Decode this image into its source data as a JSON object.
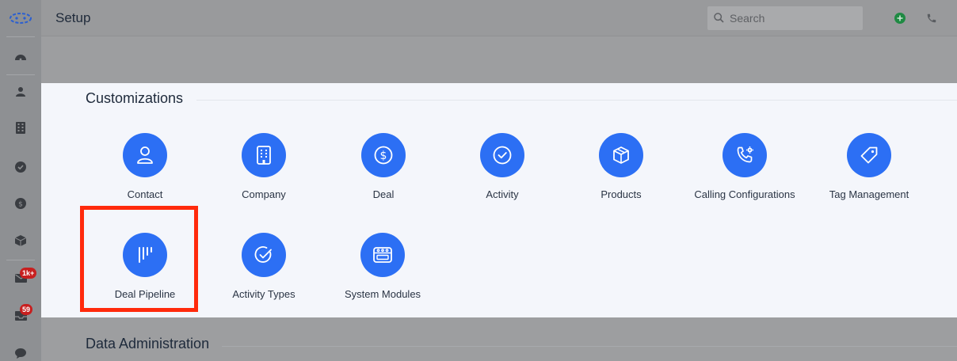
{
  "header": {
    "title": "Setup",
    "search_placeholder": "Search"
  },
  "sidebar": {
    "items": [
      {
        "icon": "logo-icon"
      },
      {
        "icon": "dashboard-icon"
      },
      {
        "icon": "contacts-icon"
      },
      {
        "icon": "companies-icon"
      },
      {
        "icon": "tasks-icon"
      },
      {
        "icon": "deals-icon"
      },
      {
        "icon": "products-icon"
      },
      {
        "icon": "email-icon",
        "badge": "1k+"
      },
      {
        "icon": "inbox-icon",
        "badge": "59"
      },
      {
        "icon": "chat-icon"
      }
    ]
  },
  "customizations": {
    "title": "Customizations",
    "tiles": [
      {
        "label": "Contact",
        "icon": "contact-icon"
      },
      {
        "label": "Company",
        "icon": "company-icon"
      },
      {
        "label": "Deal",
        "icon": "deal-icon"
      },
      {
        "label": "Activity",
        "icon": "activity-icon"
      },
      {
        "label": "Products",
        "icon": "products-icon"
      },
      {
        "label": "Calling Configurations",
        "icon": "calling-config-icon"
      },
      {
        "label": "Tag Management",
        "icon": "tag-icon"
      },
      {
        "label": "Deal Pipeline",
        "icon": "pipeline-icon"
      },
      {
        "label": "Activity Types",
        "icon": "activity-types-icon"
      },
      {
        "label": "System Modules",
        "icon": "modules-icon"
      }
    ]
  },
  "data_administration": {
    "title": "Data Administration"
  },
  "colors": {
    "accent": "#2c6ff4",
    "highlight": "#ff2a0c",
    "badge": "#c71f1f",
    "add": "#1f8a43"
  }
}
